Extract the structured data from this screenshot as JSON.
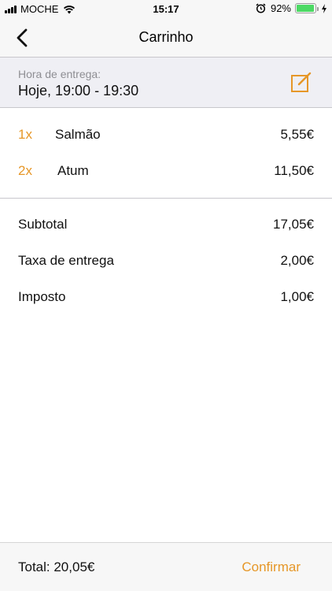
{
  "status_bar": {
    "carrier": "MOCHE",
    "time": "15:17",
    "battery": "92%",
    "battery_level": 0.92,
    "battery_color": "#4cd964"
  },
  "nav": {
    "title": "Carrinho",
    "back_icon": "chevron-left-icon"
  },
  "delivery": {
    "label": "Hora de entrega:",
    "value": "Hoje, 19:00 - 19:30",
    "edit_icon": "edit-icon"
  },
  "items": [
    {
      "qty": "1x",
      "name": "Salmão",
      "price": "5,55€"
    },
    {
      "qty": "2x",
      "name": "Atum",
      "price": "11,50€"
    }
  ],
  "summary": {
    "subtotal_label": "Subtotal",
    "subtotal_value": "17,05€",
    "delivery_fee_label": "Taxa de entrega",
    "delivery_fee_value": "2,00€",
    "tax_label": "Imposto",
    "tax_value": "1,00€"
  },
  "footer": {
    "total": "Total: 20,05€",
    "confirm_label": "Confirmar"
  },
  "colors": {
    "accent": "#e69728",
    "header_bg": "#efeff4"
  }
}
